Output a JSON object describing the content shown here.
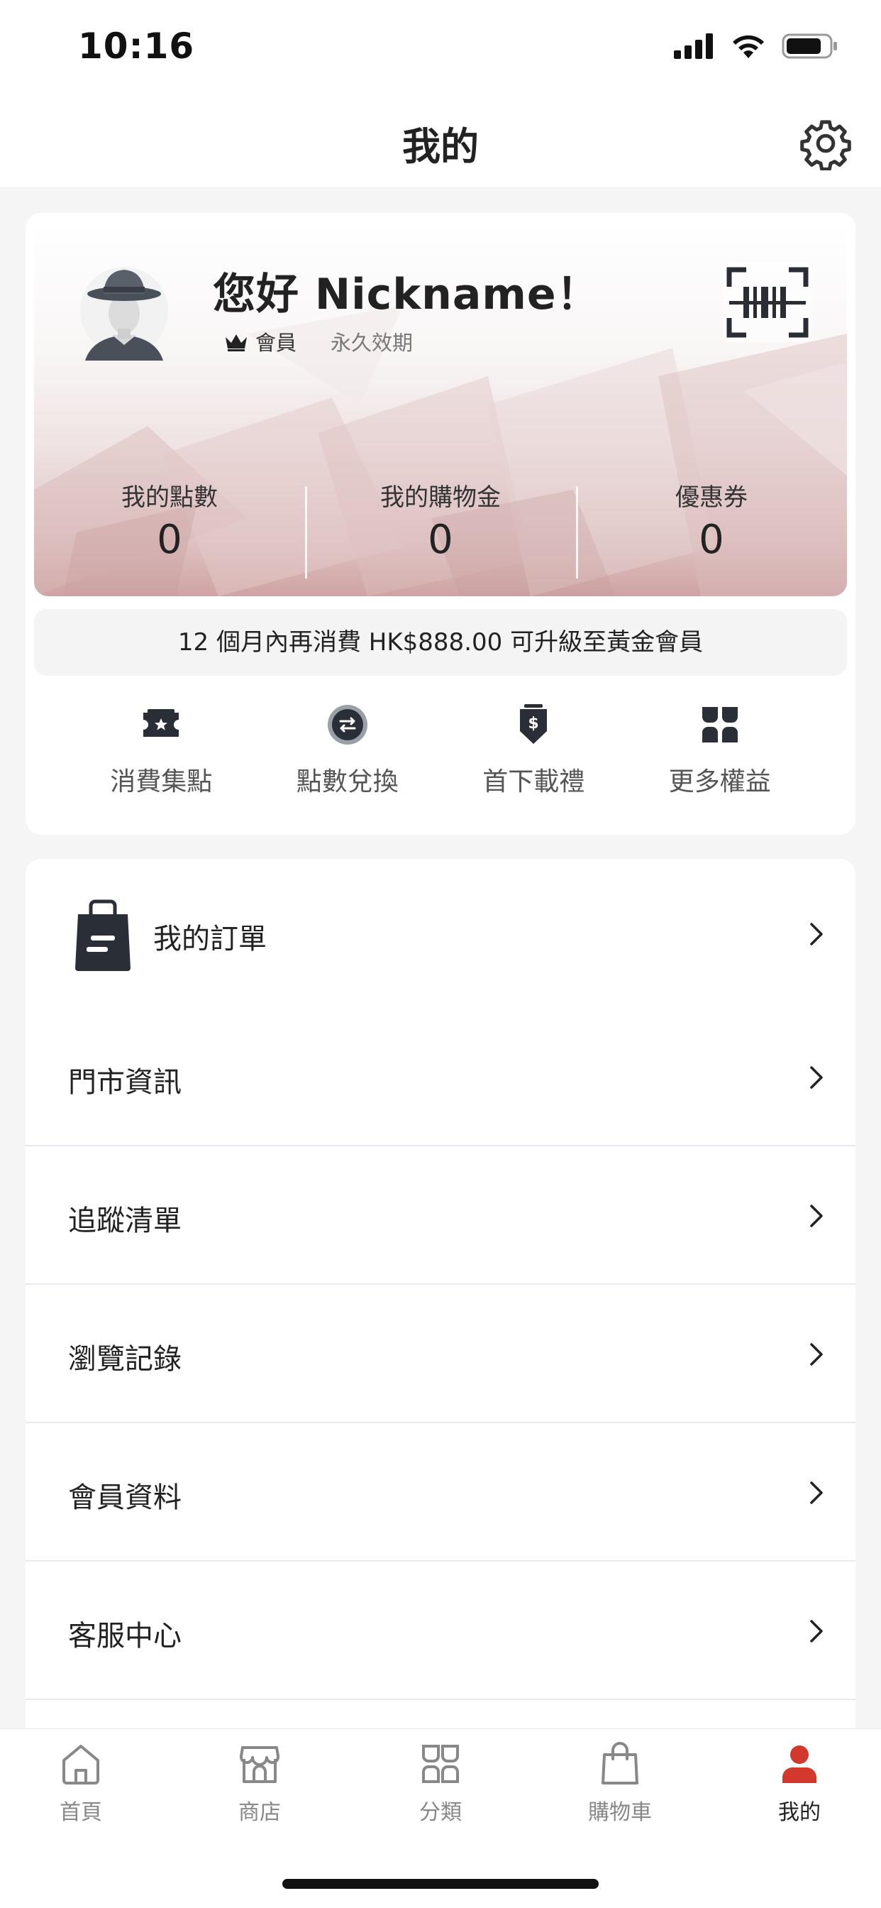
{
  "status_bar": {
    "time": "10:16"
  },
  "nav": {
    "title": "我的"
  },
  "member": {
    "greeting": "您好 Nickname！",
    "tier": "會員",
    "validity": "永久效期",
    "stats": [
      {
        "label": "我的點數",
        "value": "0"
      },
      {
        "label": "我的購物金",
        "value": "0"
      },
      {
        "label": "優惠券",
        "value": "0"
      }
    ],
    "upgrade_text": "12 個月內再消費 HK$888.00 可升級至黃金會員"
  },
  "benefits": [
    {
      "label": "消費集點",
      "icon": "ticket-star-icon"
    },
    {
      "label": "點數兌換",
      "icon": "exchange-icon"
    },
    {
      "label": "首下載禮",
      "icon": "dollar-gift-icon"
    },
    {
      "label": "更多權益",
      "icon": "more-grid-icon"
    }
  ],
  "menu": {
    "orders_label": "我的訂單",
    "items": [
      {
        "label": "門市資訊"
      },
      {
        "label": "追蹤清單"
      },
      {
        "label": "瀏覽記錄"
      },
      {
        "label": "會員資料"
      },
      {
        "label": "客服中心"
      }
    ]
  },
  "tabs": [
    {
      "label": "首頁",
      "icon": "home-icon"
    },
    {
      "label": "商店",
      "icon": "store-icon"
    },
    {
      "label": "分類",
      "icon": "category-icon"
    },
    {
      "label": "購物車",
      "icon": "shopping-bag-icon"
    },
    {
      "label": "我的",
      "icon": "profile-icon",
      "active": true
    }
  ],
  "colors": {
    "accent": "#d2382c",
    "text_primary": "#222222",
    "text_secondary": "#888888"
  }
}
